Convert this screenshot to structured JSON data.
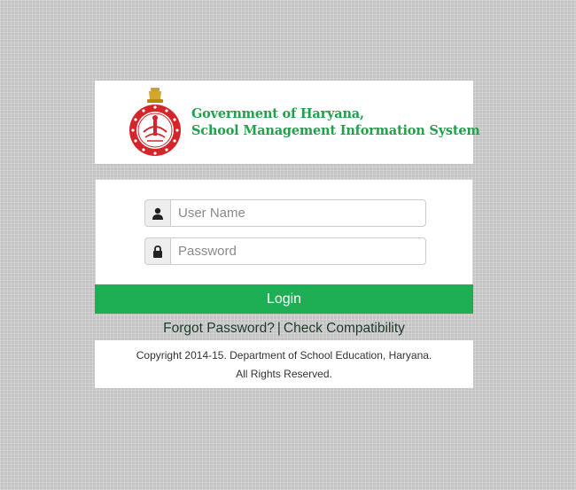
{
  "header": {
    "title_line1": "Government of Haryana,",
    "title_line2": "School Management Information System",
    "emblem_icon": "haryana-emblem-icon"
  },
  "login": {
    "username_placeholder": "User Name",
    "username_value": "",
    "username_icon": "user-icon",
    "password_placeholder": "Password",
    "password_value": "",
    "password_icon": "lock-icon",
    "login_label": "Login"
  },
  "links": {
    "forgot_password": "Forgot Password?",
    "separator": "|",
    "check_compatibility": "Check Compatibility"
  },
  "footer": {
    "copyright": "Copyright 2014-15. Department of School Education, Haryana.",
    "rights": "All Rights Reserved."
  },
  "colors": {
    "brand_green": "#1eae53",
    "title_green": "#22a04b",
    "emblem_red": "#d4262a",
    "background": "#c4c4c4"
  }
}
